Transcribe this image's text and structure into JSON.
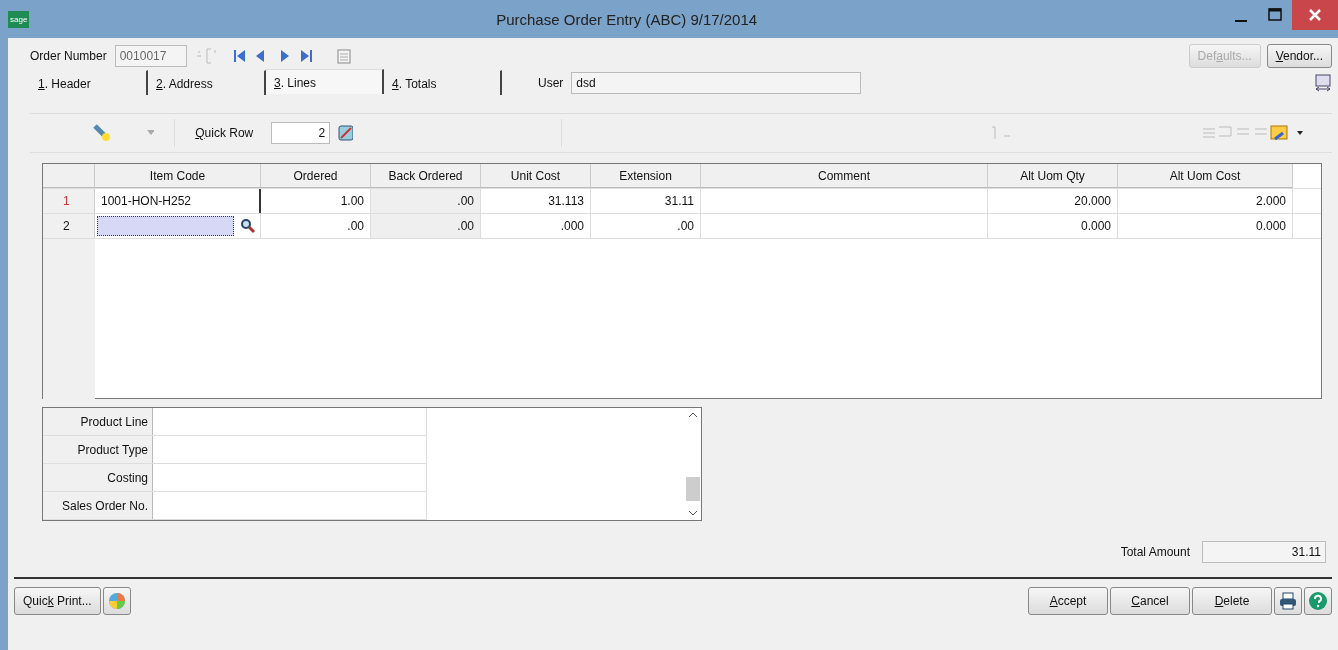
{
  "window": {
    "logo": "sage",
    "title": "Purchase Order Entry (ABC) 9/17/2014"
  },
  "order": {
    "label": "Order Number",
    "value": "0010017"
  },
  "top_buttons": [
    {
      "pre": "Def",
      "key": "a",
      "post": "ults...",
      "disabled": true
    },
    {
      "key": "V",
      "post": "endor...",
      "disabled": false
    }
  ],
  "tabs": [
    {
      "key": "1",
      "post": ". Header",
      "selected": false
    },
    {
      "key": "2",
      "post": ". Address",
      "selected": false
    },
    {
      "key": "3",
      "post": ". Lines",
      "selected": true
    },
    {
      "key": "4",
      "post": ". Totals",
      "selected": false
    }
  ],
  "user": {
    "label": "User",
    "value": "dsd"
  },
  "quick_row": {
    "key": "Q",
    "post": "uick Row",
    "value": "2"
  },
  "grid": {
    "columns": [
      {
        "label": "Item Code",
        "kind": "code"
      },
      {
        "label": "Ordered",
        "kind": "number"
      },
      {
        "label": "Back Ordered",
        "kind": "shaded"
      },
      {
        "label": "Unit Cost",
        "kind": "number"
      },
      {
        "label": "Extension",
        "kind": "number"
      },
      {
        "label": "Comment",
        "kind": "text"
      },
      {
        "label": "Alt Uom Qty",
        "kind": "number"
      },
      {
        "label": "Alt Uom Cost",
        "kind": "number"
      }
    ],
    "rows": [
      {
        "number": "1",
        "kind": "saved",
        "item_code": "1001-HON-H252",
        "values": [
          "1.00",
          ".00",
          "31.113",
          "31.11",
          "20.000",
          "2.000"
        ]
      },
      {
        "number": "2",
        "kind": "editing",
        "values": [
          ".00",
          ".00",
          ".000",
          ".00",
          "0.000",
          "0.000"
        ]
      }
    ]
  },
  "details": [
    "Product Line",
    "Product Type",
    "Costing",
    "Sales Order No."
  ],
  "total": {
    "label": "Total Amount",
    "value": "31.11"
  },
  "bottom_left": [
    {
      "pre": "Quic",
      "key": "k",
      "post": " Print..."
    }
  ],
  "bottom_right": [
    {
      "key": "A",
      "post": "ccept"
    },
    {
      "key": "C",
      "post": "ancel"
    },
    {
      "key": "D",
      "post": "elete"
    }
  ]
}
